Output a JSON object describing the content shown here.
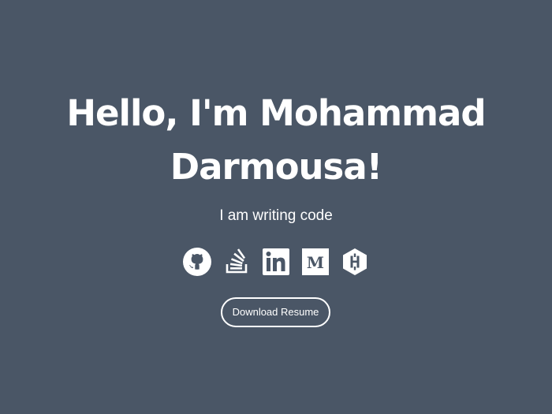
{
  "hero": {
    "title_line1": "Hello, I'm Mohammad",
    "title_line2": "Darmousa!",
    "subtitle": "I am writing code",
    "resume_button_label": "Download Resume"
  },
  "socials": [
    {
      "name": "github",
      "icon": "github-icon"
    },
    {
      "name": "stack-overflow",
      "icon": "stack-overflow-icon"
    },
    {
      "name": "linkedin",
      "icon": "linkedin-icon"
    },
    {
      "name": "medium",
      "icon": "medium-icon"
    },
    {
      "name": "hashnode",
      "icon": "hashnode-icon"
    }
  ],
  "colors": {
    "background": "#4a5666",
    "foreground": "#ffffff"
  }
}
